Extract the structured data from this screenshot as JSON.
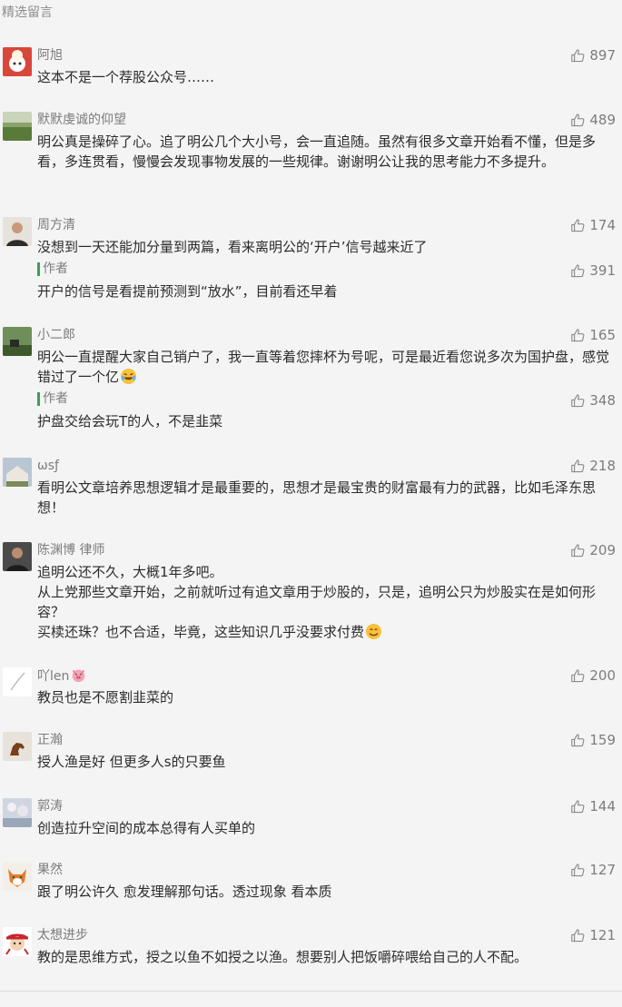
{
  "section_title": "精选留言",
  "comments": [
    {
      "name": "阿旭",
      "likes": "897",
      "text": "这本不是一个荐股公众号……"
    },
    {
      "name": "默默虔诚的仰望",
      "likes": "489",
      "text": "明公真是操碎了心。追了明公几个大小号，会一直追随。虽然有很多文章开始看不懂，但是多看，多连贯看，慢慢会发现事物发展的一些规律。谢谢明公让我的思考能力不多提升。"
    },
    {
      "name": "周方清",
      "likes": "174",
      "text": "没想到一天还能加分量到两篇，看来离明公的‘开户’信号越来近了",
      "reply": {
        "label": "作者",
        "likes": "391",
        "text": "开户的信号是看提前预测到“放水”，目前看还早着"
      }
    },
    {
      "name": "小二郎",
      "likes": "165",
      "text": "明公一直提醒大家自己销户了，我一直等着您摔杯为号呢，可是最近看您说多次为国护盘，感觉错过了一个亿",
      "reply": {
        "label": "作者",
        "likes": "348",
        "text": "护盘交给会玩T的人，不是韭菜"
      }
    },
    {
      "name": "ωsƒ",
      "likes": "218",
      "text": "看明公文章培养思想逻辑才是最重要的，思想才是最宝贵的财富最有力的武器，比如毛泽东思想！"
    },
    {
      "name": "陈渊博 律师",
      "likes": "209",
      "line1": "追明公还不久，大概1年多吧。",
      "line2": "从上党那些文章开始，之前就听过有追文章用于炒股的，只是，追明公只为炒股实在是如何形容？",
      "line3": "买椟还珠？也不合适，毕竟，这些知识几乎没要求付费"
    },
    {
      "name": "吖len",
      "likes": "200",
      "text": "教员也是不愿割韭菜的"
    },
    {
      "name": "正瀚",
      "likes": "159",
      "text": "授人渔是好 但更多人s的只要鱼"
    },
    {
      "name": "郭涛",
      "likes": "144",
      "text": "创造拉升空间的成本总得有人买单的"
    },
    {
      "name": "果然",
      "likes": "127",
      "text": "跟了明公许久 愈发理解那句话。透过现象 看本质"
    },
    {
      "name": "太想进步",
      "likes": "121",
      "text": "教的是思维方式，授之以鱼不如授之以渔。想要别人把饭嚼碎喂给自己的人不配。"
    }
  ],
  "icons": {
    "like": "thumbs-up-icon",
    "laugh_emoji": "laughing-tears-emoji",
    "smile_emoji": "smile-emoji",
    "pig_emoji": "pig-face-emoji"
  },
  "colors": {
    "author_bar": "#35a25c",
    "muted": "#7c7c7c",
    "text": "#2b2b2b"
  }
}
